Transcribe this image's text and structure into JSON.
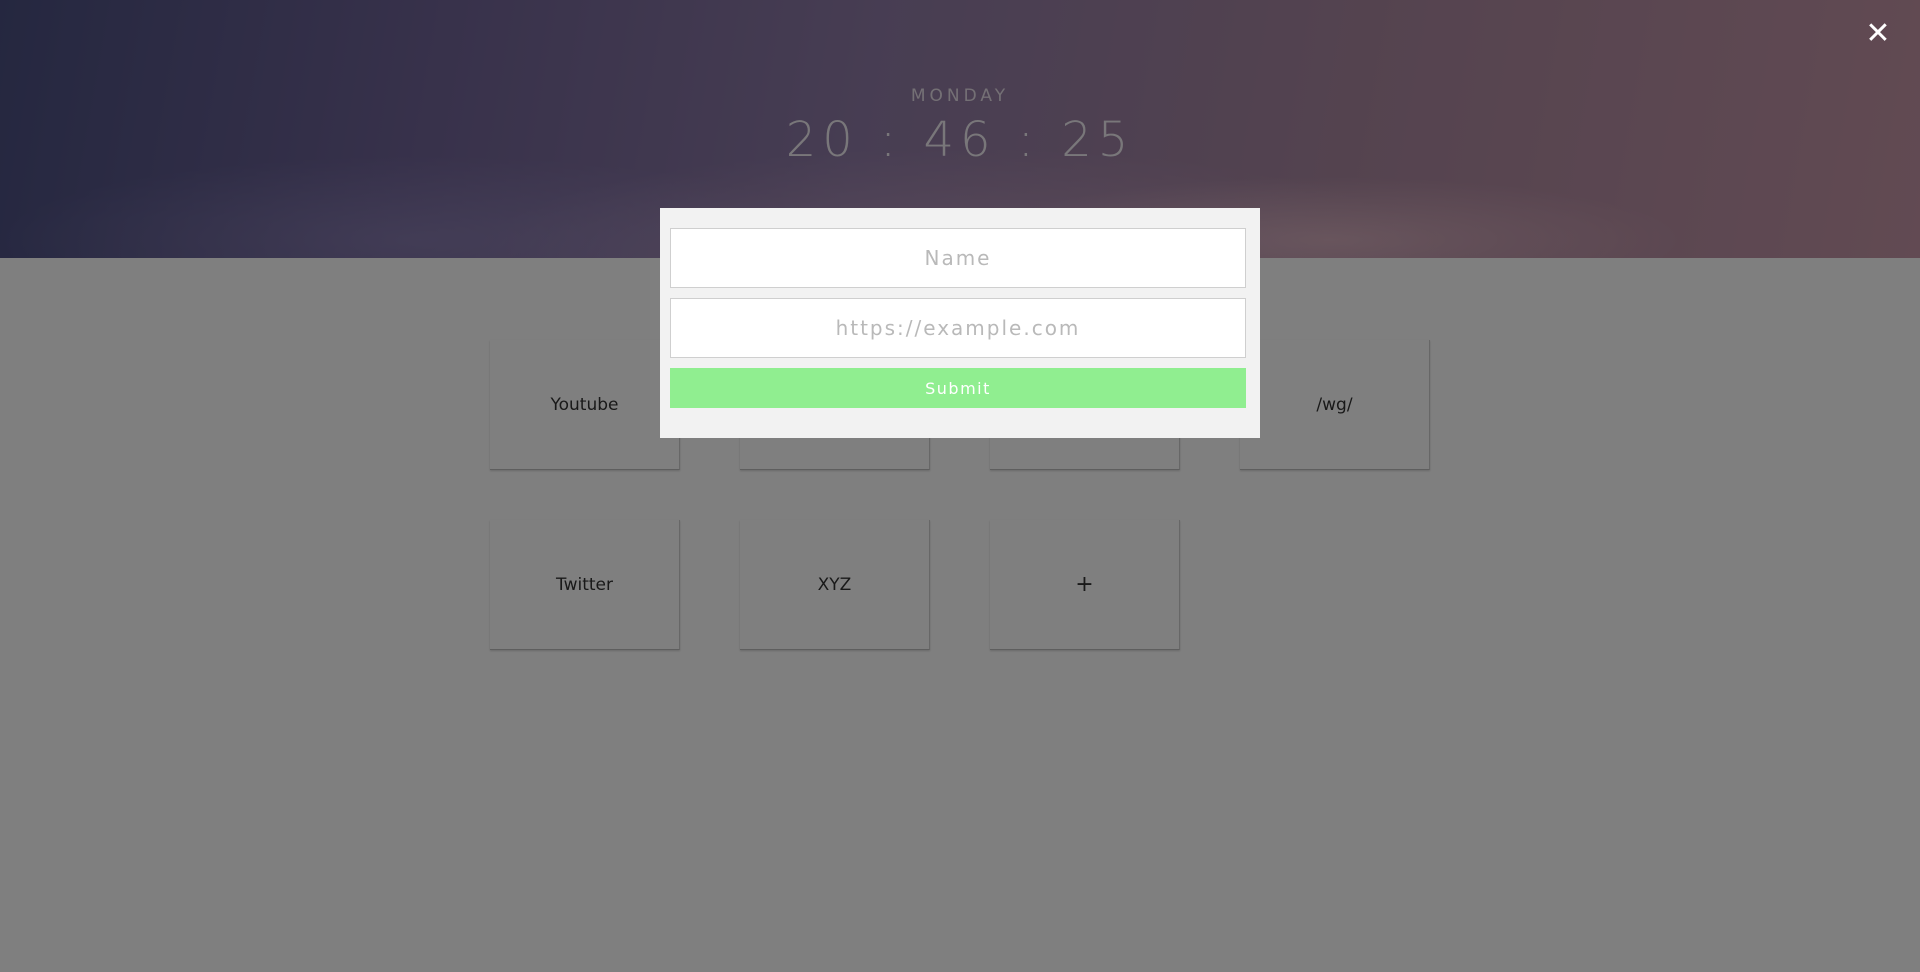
{
  "header": {
    "day": "MONDAY",
    "time": "20 : 46 : 25"
  },
  "tiles": [
    {
      "label": "Youtube"
    },
    {
      "label": ""
    },
    {
      "label": ""
    },
    {
      "label": "/wg/"
    },
    {
      "label": "Twitter"
    },
    {
      "label": "XYZ"
    },
    {
      "label": "+"
    }
  ],
  "modal": {
    "name_placeholder": "Name",
    "url_placeholder": "https://example.com",
    "submit_label": "Submit",
    "submit_color": "#90ee90"
  },
  "close": {
    "icon": "close-icon",
    "glyph": "✕"
  }
}
